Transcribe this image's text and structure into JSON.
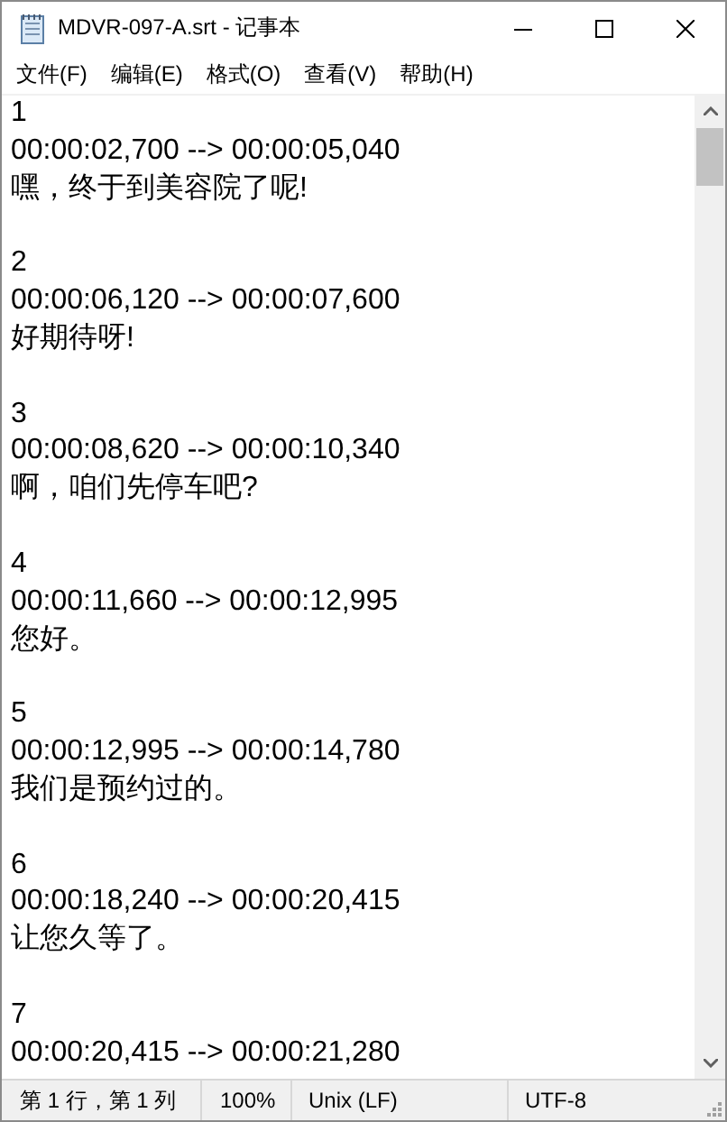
{
  "window": {
    "title": "MDVR-097-A.srt - 记事本"
  },
  "menu": [
    "文件(F)",
    "编辑(E)",
    "格式(O)",
    "查看(V)",
    "帮助(H)"
  ],
  "subtitles": [
    {
      "index": "1",
      "timing": "00:00:02,700 --> 00:00:05,040",
      "text": "嘿，终于到美容院了呢!"
    },
    {
      "index": "2",
      "timing": "00:00:06,120 --> 00:00:07,600",
      "text": "好期待呀!"
    },
    {
      "index": "3",
      "timing": "00:00:08,620 --> 00:00:10,340",
      "text": "啊，咱们先停车吧?"
    },
    {
      "index": "4",
      "timing": "00:00:11,660 --> 00:00:12,995",
      "text": "您好。"
    },
    {
      "index": "5",
      "timing": "00:00:12,995 --> 00:00:14,780",
      "text": "我们是预约过的。"
    },
    {
      "index": "6",
      "timing": "00:00:18,240 --> 00:00:20,415",
      "text": "让您久等了。"
    },
    {
      "index": "7",
      "timing": "00:00:20,415 --> 00:00:21,280"
    }
  ],
  "status_bar": [
    "第 1 行，第 1 列",
    "100%",
    "Unix (LF)",
    "UTF-8"
  ]
}
